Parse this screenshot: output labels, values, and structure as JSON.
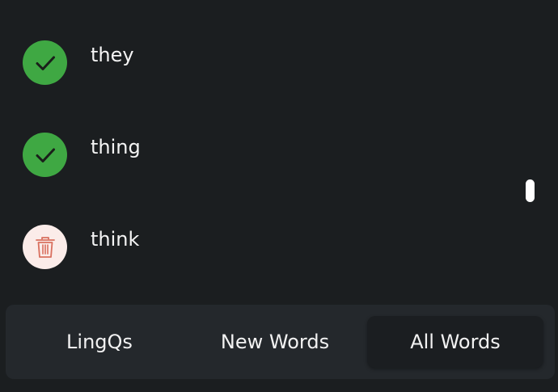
{
  "words": [
    {
      "text": "they",
      "status": "known",
      "icon": "check-icon"
    },
    {
      "text": "thing",
      "status": "known",
      "icon": "check-icon"
    },
    {
      "text": "think",
      "status": "delete",
      "icon": "trash-icon"
    }
  ],
  "tabs": {
    "lingqs": "LingQs",
    "new_words": "New Words",
    "all_words": "All Words",
    "selected": "all_words"
  },
  "colors": {
    "background": "#1b1e20",
    "known_green": "#3fa843",
    "delete_bg": "#fbece9",
    "delete_icon": "#d9705f",
    "bar_bg": "#24282c"
  }
}
